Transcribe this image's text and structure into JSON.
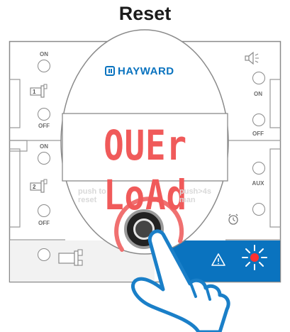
{
  "title": "Reset",
  "brand": "HAYWARD",
  "display": {
    "text": "OUEr LoAd",
    "color": "#f05a5a"
  },
  "left_panel": {
    "pump1": {
      "on_label": "ON",
      "off_label": "OFF",
      "number": "1"
    },
    "pump2": {
      "on_label": "ON",
      "off_label": "OFF",
      "number": "2"
    }
  },
  "right_panel": {
    "speaker": {
      "on_label": "ON",
      "off_label": "OFF"
    },
    "aux_label": "AUX"
  },
  "hints": {
    "push_reset_line1": "push to",
    "push_reset_line2": "reset",
    "push_man_line1": "push>4s",
    "push_man_line2": "man"
  },
  "colors": {
    "accent_blue": "#0a73bf",
    "ring_red": "#f07070",
    "hand_blue": "#1a7fc8",
    "panel_grey": "#f2f2f2"
  },
  "icons": [
    "speaker-icon",
    "pump-icon",
    "alarm-clock-icon",
    "warning-icon",
    "error-light-icon",
    "hand-pointer-icon"
  ]
}
